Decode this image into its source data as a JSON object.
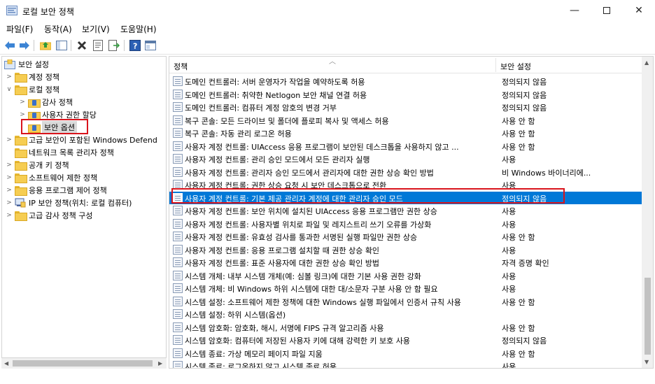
{
  "window": {
    "title": "로컬 보안 정책",
    "icon": "security-policy-icon",
    "minimize": "—",
    "close": "✕"
  },
  "menu": [
    "파일(F)",
    "동작(A)",
    "보기(V)",
    "도움말(H)"
  ],
  "toolbar": [
    "back-icon",
    "forward-icon",
    "up-folder-icon",
    "show-tree-icon",
    "delete-icon",
    "properties-icon",
    "export-icon",
    "help-icon",
    "panel-icon"
  ],
  "tree": [
    {
      "label": "보안 설정",
      "level": 0,
      "expanded": true,
      "icon": "root"
    },
    {
      "label": "계정 정책",
      "level": 1,
      "expanded": false
    },
    {
      "label": "로컬 정책",
      "level": 1,
      "expanded": true
    },
    {
      "label": "감사 정책",
      "level": 2,
      "expanded": false
    },
    {
      "label": "사용자 권한 할당",
      "level": 2,
      "expanded": false
    },
    {
      "label": "보안 옵션",
      "level": 2,
      "expanded": null,
      "selected": true
    },
    {
      "label": "고급 보안이 포함된 Windows Defend",
      "level": 1,
      "expanded": false
    },
    {
      "label": "네트워크 목록 관리자 정책",
      "level": 1,
      "expanded": null
    },
    {
      "label": "공개 키 정책",
      "level": 1,
      "expanded": false
    },
    {
      "label": "소프트웨어 제한 정책",
      "level": 1,
      "expanded": false
    },
    {
      "label": "응용 프로그램 제어 정책",
      "level": 1,
      "expanded": false
    },
    {
      "label": "IP 보안 정책(위치: 로컬 컴퓨터)",
      "level": 1,
      "expanded": null,
      "icon": "ipsec"
    },
    {
      "label": "고급 감사 정책 구성",
      "level": 1,
      "expanded": false
    }
  ],
  "list": {
    "col_policy": "정책",
    "col_setting": "보안 설정",
    "rows": [
      {
        "policy": "도메인 컨트롤러: 서버 운영자가 작업을 예약하도록 허용",
        "setting": "정의되지 않음"
      },
      {
        "policy": "도메인 컨트롤러: 취약한 Netlogon 보안 채널 연결 허용",
        "setting": "정의되지 않음"
      },
      {
        "policy": "도메인 컨트롤러: 컴퓨터 계정 암호의 변경 거부",
        "setting": "정의되지 않음"
      },
      {
        "policy": "복구 콘솔: 모든 드라이브 및 폴더에 플로피 복사 및 액세스 허용",
        "setting": "사용 안 함"
      },
      {
        "policy": "복구 콘솔: 자동 관리 로그온 허용",
        "setting": "사용 안 함"
      },
      {
        "policy": "사용자 계정 컨트롤: UIAccess 응용 프로그램이 보안된 데스크톱을 사용하지 않고 ...",
        "setting": "사용 안 함"
      },
      {
        "policy": "사용자 계정 컨트롤: 관리 승인 모드에서 모든 관리자 실행",
        "setting": "사용"
      },
      {
        "policy": "사용자 계정 컨트롤: 관리자 승인 모드에서 관리자에 대한 권한 상승 확인 방법",
        "setting": "비 Windows 바이너리에..."
      },
      {
        "policy": "사용자 계정 컨트롤: 권한 상승 요청 시 보안 데스크톱으로 전환",
        "setting": "사용"
      },
      {
        "policy": "사용자 계정 컨트롤: 기본 제공 관리자 계정에 대한 관리자 승인 모드",
        "setting": "정의되지 않음",
        "selected": true
      },
      {
        "policy": "사용자 계정 컨트롤: 보안 위치에 설치된 UIAccess 응용 프로그램만 권한 상승",
        "setting": "사용"
      },
      {
        "policy": "사용자 계정 컨트롤: 사용자별 위치로 파일 및 레지스트리 쓰기 오류를 가상화",
        "setting": "사용"
      },
      {
        "policy": "사용자 계정 컨트롤: 유효성 검사를 통과한 서명된 실행 파일만 권한 상승",
        "setting": "사용 안 함"
      },
      {
        "policy": "사용자 계정 컨트롤: 응용 프로그램 설치할 때 권한 상승 확인",
        "setting": "사용"
      },
      {
        "policy": "사용자 계정 컨트롤: 표준 사용자에 대한 권한 상승 확인 방법",
        "setting": "자격 증명 확인"
      },
      {
        "policy": "시스템 개체: 내부 시스템 개체(예: 심볼 링크)에 대한 기본 사용 권한 강화",
        "setting": "사용"
      },
      {
        "policy": "시스템 개체: 비 Windows 하위 시스템에 대한 대/소문자 구분 사용 안 함 필요",
        "setting": "사용"
      },
      {
        "policy": "시스템 설정: 소프트웨어 제한 정책에 대한 Windows 실행 파일에서 인증서 규칙 사용",
        "setting": "사용 안 함"
      },
      {
        "policy": "시스템 설정: 하위 시스템(옵션)",
        "setting": ""
      },
      {
        "policy": "시스템 암호화: 암호화, 해시, 서명에 FIPS 규격 알고리즘 사용",
        "setting": "사용 안 함"
      },
      {
        "policy": "시스템 암호화: 컴퓨터에 저장된 사용자 키에 대해 강력한 키 보호 사용",
        "setting": "정의되지 않음"
      },
      {
        "policy": "시스템 종료: 가상 메모리 페이지 파일 지움",
        "setting": "사용 안 함"
      },
      {
        "policy": "시스템 종료: 로그온하지 않고 시스템 종료 허용",
        "setting": "사용"
      }
    ]
  },
  "colors": {
    "selection": "#0078d7",
    "highlight_box": "#d9141c"
  }
}
